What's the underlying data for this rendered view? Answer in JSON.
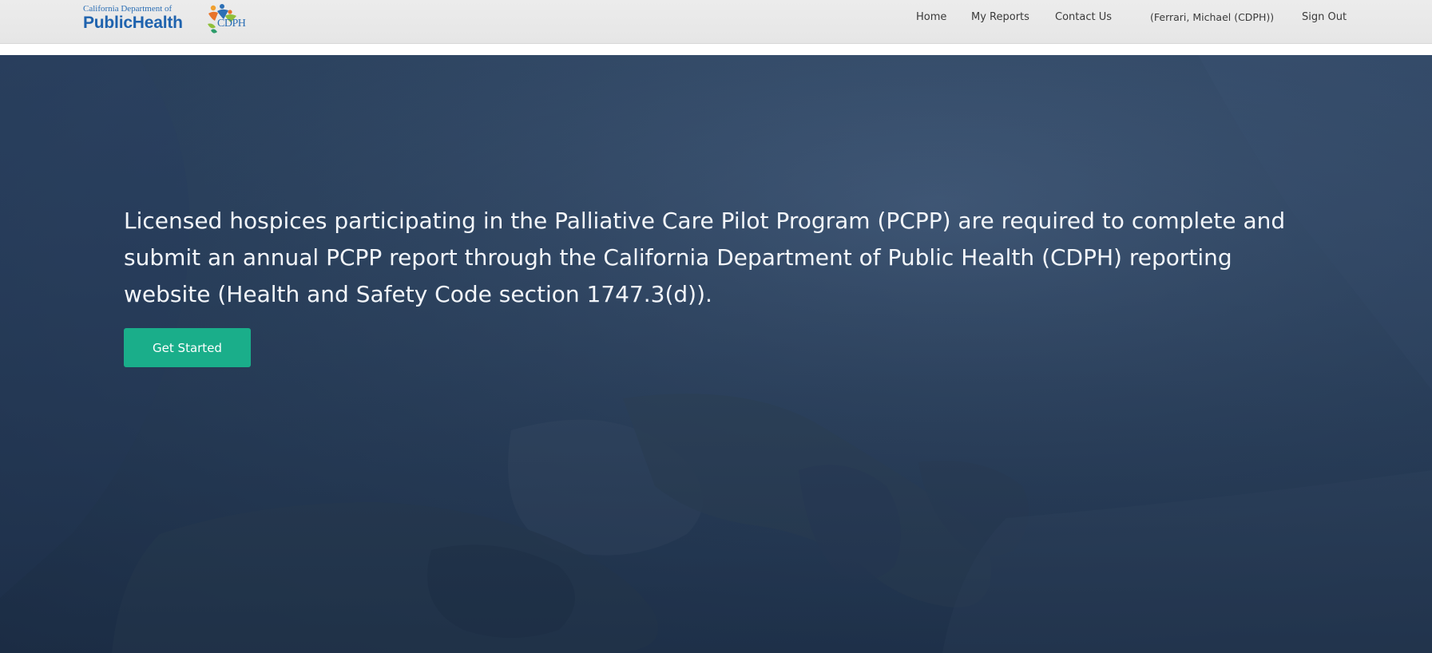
{
  "header": {
    "logo": {
      "top_text": "California Department of",
      "name_bold": "PublicHealth",
      "mark_text": "CDPH",
      "mark_icon": "people-figures-icon"
    },
    "nav": {
      "home": "Home",
      "my_reports": "My Reports",
      "contact_us": "Contact Us",
      "user": "(Ferrari, Michael (CDPH))",
      "sign_out": "Sign Out"
    }
  },
  "hero": {
    "background_image": "holding-hands-photo",
    "text": "Licensed hospices participating in the Palliative Care Pilot Program (PCPP) are required to complete and submit an annual PCPP report through the California Department of Public Health (CDPH) reporting website (Health and Safety Code section 1747.3(d)).",
    "button_label": "Get Started"
  },
  "colors": {
    "header_bg": "#e8e8e8",
    "hero_overlay": "#2d4461",
    "button": "#1aae8a",
    "logo_blue": "#1f63ae"
  }
}
